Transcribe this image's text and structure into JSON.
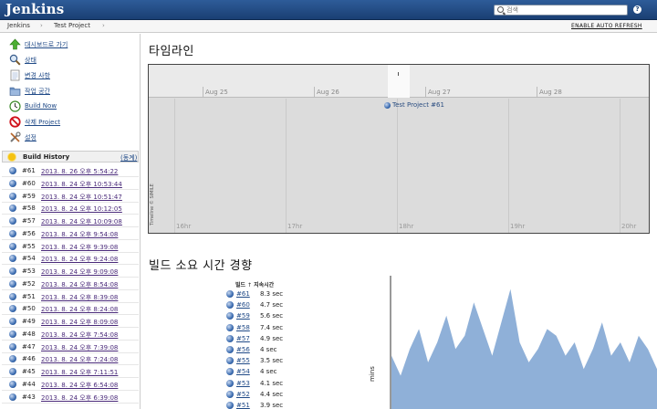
{
  "header": {
    "logo": "Jenkins",
    "search_placeholder": "검색",
    "help": "?"
  },
  "breadcrumb": {
    "items": [
      "Jenkins",
      "Test Project"
    ],
    "auto_refresh": "ENABLE AUTO REFRESH"
  },
  "sidebar": {
    "tasks": [
      {
        "label": "대시보드로 가기",
        "icon": "up-arrow-icon"
      },
      {
        "label": "상태",
        "icon": "magnifier-icon"
      },
      {
        "label": "변경 사항",
        "icon": "notepad-icon"
      },
      {
        "label": "작업 공간",
        "icon": "folder-icon"
      },
      {
        "label": "Build Now",
        "icon": "clock-icon"
      },
      {
        "label": "삭제 Project",
        "icon": "no-entry-icon"
      },
      {
        "label": "설정",
        "icon": "tools-icon"
      }
    ],
    "build_history": {
      "title": "Build History",
      "trend_label": "(동계)",
      "builds": [
        {
          "num": "#61",
          "date": "2013. 8. 26 오후 5:54:22"
        },
        {
          "num": "#60",
          "date": "2013. 8. 24 오후 10:53:44"
        },
        {
          "num": "#59",
          "date": "2013. 8. 24 오후 10:51:47"
        },
        {
          "num": "#58",
          "date": "2013. 8. 24 오후 10:12:05"
        },
        {
          "num": "#57",
          "date": "2013. 8. 24 오후 10:09:08"
        },
        {
          "num": "#56",
          "date": "2013. 8. 24 오후 9:54:08"
        },
        {
          "num": "#55",
          "date": "2013. 8. 24 오후 9:39:08"
        },
        {
          "num": "#54",
          "date": "2013. 8. 24 오후 9:24:08"
        },
        {
          "num": "#53",
          "date": "2013. 8. 24 오후 9:09:08"
        },
        {
          "num": "#52",
          "date": "2013. 8. 24 오후 8:54:08"
        },
        {
          "num": "#51",
          "date": "2013. 8. 24 오후 8:39:08"
        },
        {
          "num": "#50",
          "date": "2013. 8. 24 오후 8:24:08"
        },
        {
          "num": "#49",
          "date": "2013. 8. 24 오후 8:09:08"
        },
        {
          "num": "#48",
          "date": "2013. 8. 24 오후 7:54:08"
        },
        {
          "num": "#47",
          "date": "2013. 8. 24 오후 7:39:08"
        },
        {
          "num": "#46",
          "date": "2013. 8. 24 오후 7:24:08"
        },
        {
          "num": "#45",
          "date": "2013. 8. 24 오후 7:11:51"
        },
        {
          "num": "#44",
          "date": "2013. 8. 24 오후 6:54:08"
        },
        {
          "num": "#43",
          "date": "2013. 8. 24 오후 6:39:08"
        }
      ]
    }
  },
  "timeline": {
    "title": "타임라인",
    "days": [
      "Aug 25",
      "Aug 26",
      "Aug 27",
      "Aug 28"
    ],
    "hours": [
      "16hr",
      "17hr",
      "18hr",
      "19hr",
      "20hr"
    ],
    "event": "Test Project #61",
    "credit": "Timeline © SIMILE"
  },
  "trend": {
    "title": "빌드 소요 시간 경향",
    "col_build": "빌드",
    "col_arrow": "↑",
    "col_duration": "지속시간",
    "rows": [
      {
        "num": "#61",
        "dur": "8.3 sec"
      },
      {
        "num": "#60",
        "dur": "4.7 sec"
      },
      {
        "num": "#59",
        "dur": "5.6 sec"
      },
      {
        "num": "#58",
        "dur": "7.4 sec"
      },
      {
        "num": "#57",
        "dur": "4.9 sec"
      },
      {
        "num": "#56",
        "dur": "4 sec"
      },
      {
        "num": "#55",
        "dur": "3.5 sec"
      },
      {
        "num": "#54",
        "dur": "4 sec"
      },
      {
        "num": "#53",
        "dur": "4.1 sec"
      },
      {
        "num": "#52",
        "dur": "4.4 sec"
      },
      {
        "num": "#51",
        "dur": "3.9 sec"
      }
    ],
    "y_label": "mins",
    "fill_color": "#8fb0d8"
  },
  "chart_data": {
    "type": "area",
    "ylabel": "mins",
    "series": [
      {
        "values": [
          0.08,
          0.05,
          0.09,
          0.12,
          0.07,
          0.1,
          0.14,
          0.09,
          0.11,
          0.16,
          0.12,
          0.08,
          0.13,
          0.18,
          0.1,
          0.07,
          0.09,
          0.12,
          0.11,
          0.08,
          0.1,
          0.06,
          0.09,
          0.13,
          0.08,
          0.1,
          0.07,
          0.11,
          0.09,
          0.06
        ]
      }
    ]
  }
}
